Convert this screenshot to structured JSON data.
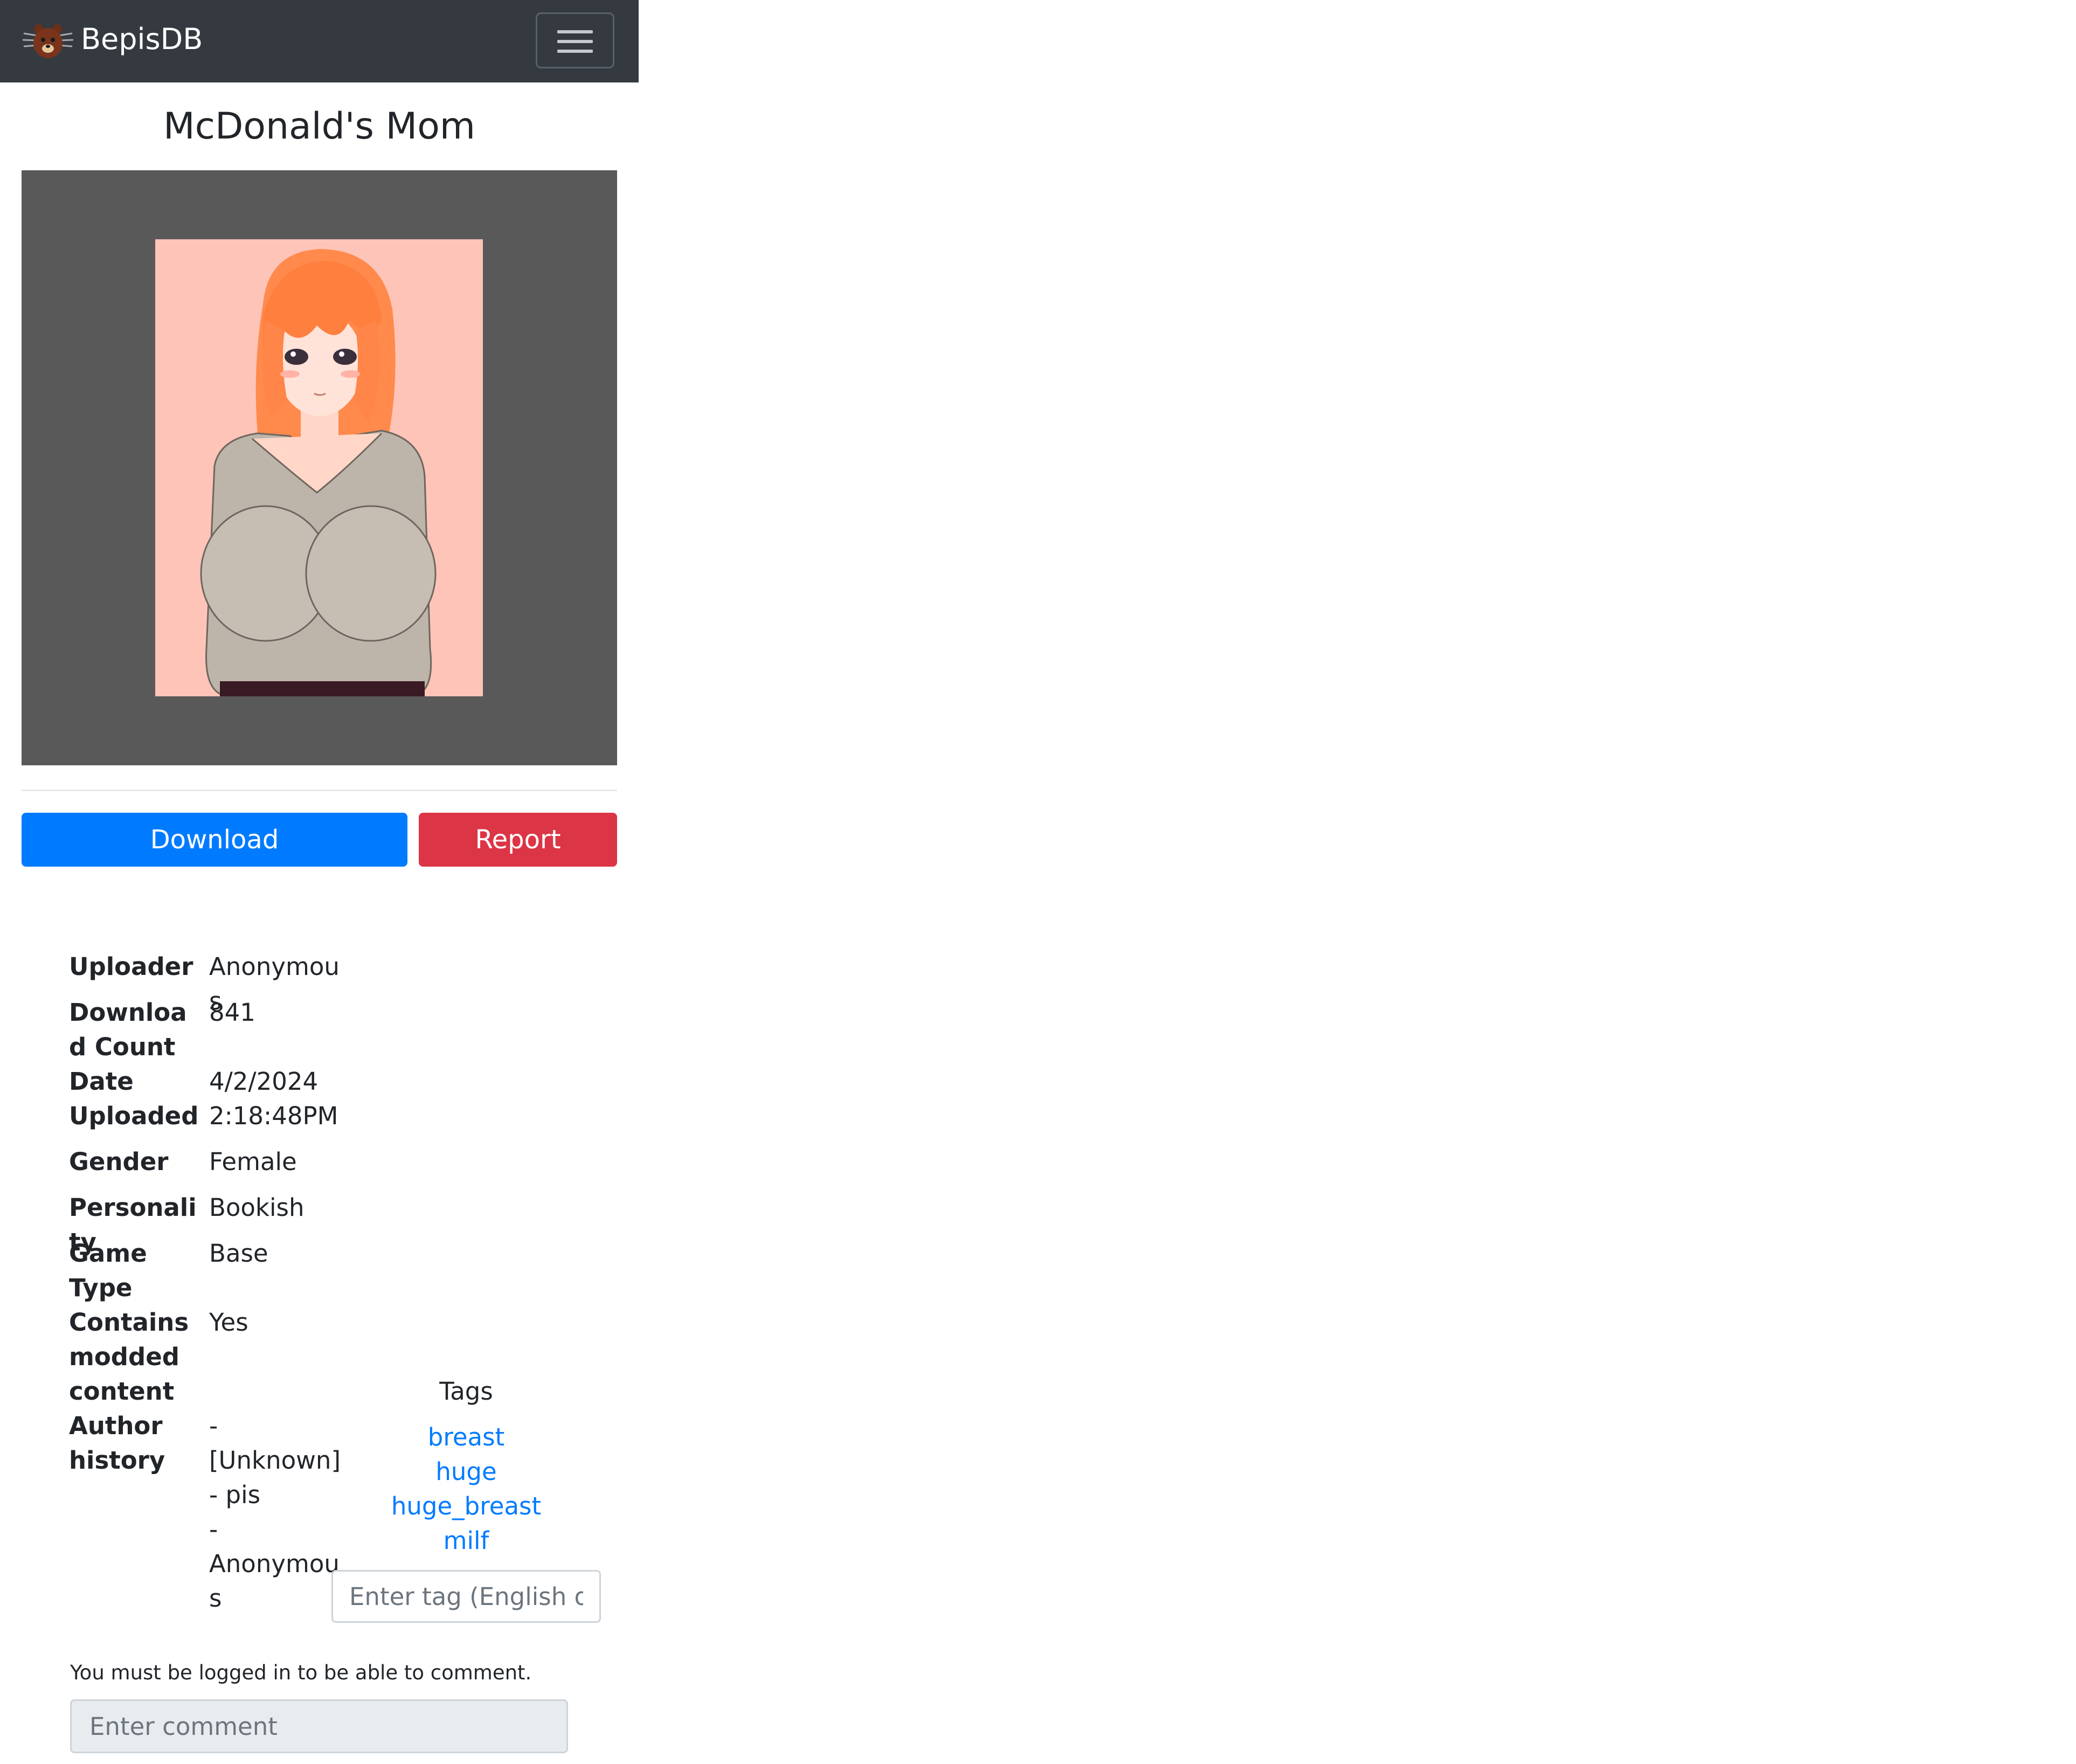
{
  "navbar": {
    "brand_name": "BepisDB",
    "logo_icon": "bear-logo-icon",
    "menu_icon": "hamburger-menu-icon"
  },
  "card": {
    "title": "McDonald's Mom",
    "preview_image": "character-card-illustration"
  },
  "actions": {
    "download_label": "Download",
    "report_label": "Report"
  },
  "info": [
    {
      "label": "Uploader",
      "value": "Anonymous"
    },
    {
      "label": "Download Count",
      "value": "841"
    },
    {
      "label": "Date Uploaded",
      "value": "4/2/2024 2:18:48PM"
    },
    {
      "label": "Gender",
      "value": "Female"
    },
    {
      "label": "Personality",
      "value": "Bookish"
    },
    {
      "label": "Game Type",
      "value": "Base"
    },
    {
      "label": "Contains modded content",
      "value": "Yes"
    },
    {
      "label": "Author history",
      "value": "- [Unknown]\n- pis\n- Anonymous"
    }
  ],
  "tags": {
    "heading": "Tags",
    "items": [
      "breast",
      "huge",
      "huge_breast",
      "milf"
    ],
    "input_placeholder": "Enter tag (English only)"
  },
  "comments": {
    "login_note": "You must be logged in to be able to comment.",
    "input_placeholder": "Enter comment"
  },
  "colors": {
    "navbar_bg": "#343a40",
    "primary": "#007bff",
    "danger": "#dc3545",
    "link": "#007bff"
  }
}
